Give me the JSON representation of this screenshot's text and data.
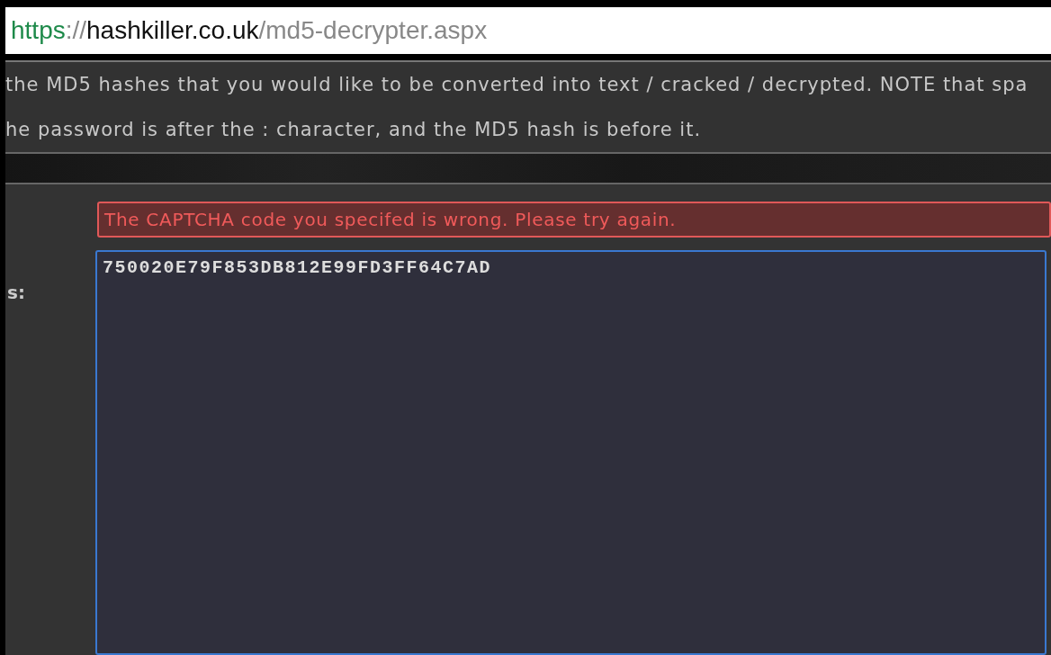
{
  "address_bar": {
    "scheme": "https",
    "separator": "://",
    "domain": "hashkiller.co.uk",
    "path": "/md5-decrypter.aspx"
  },
  "instructions": [
    "the MD5 hashes that you would like to be converted into text / cracked / decrypted. NOTE that spa",
    "he password is after the : character, and the MD5 hash is before it."
  ],
  "form": {
    "error": "The CAPTCHA code you specifed is wrong. Please try again.",
    "label": "s:",
    "hashes_value": "750020E79F853DB812E99FD3FF64C7AD"
  }
}
